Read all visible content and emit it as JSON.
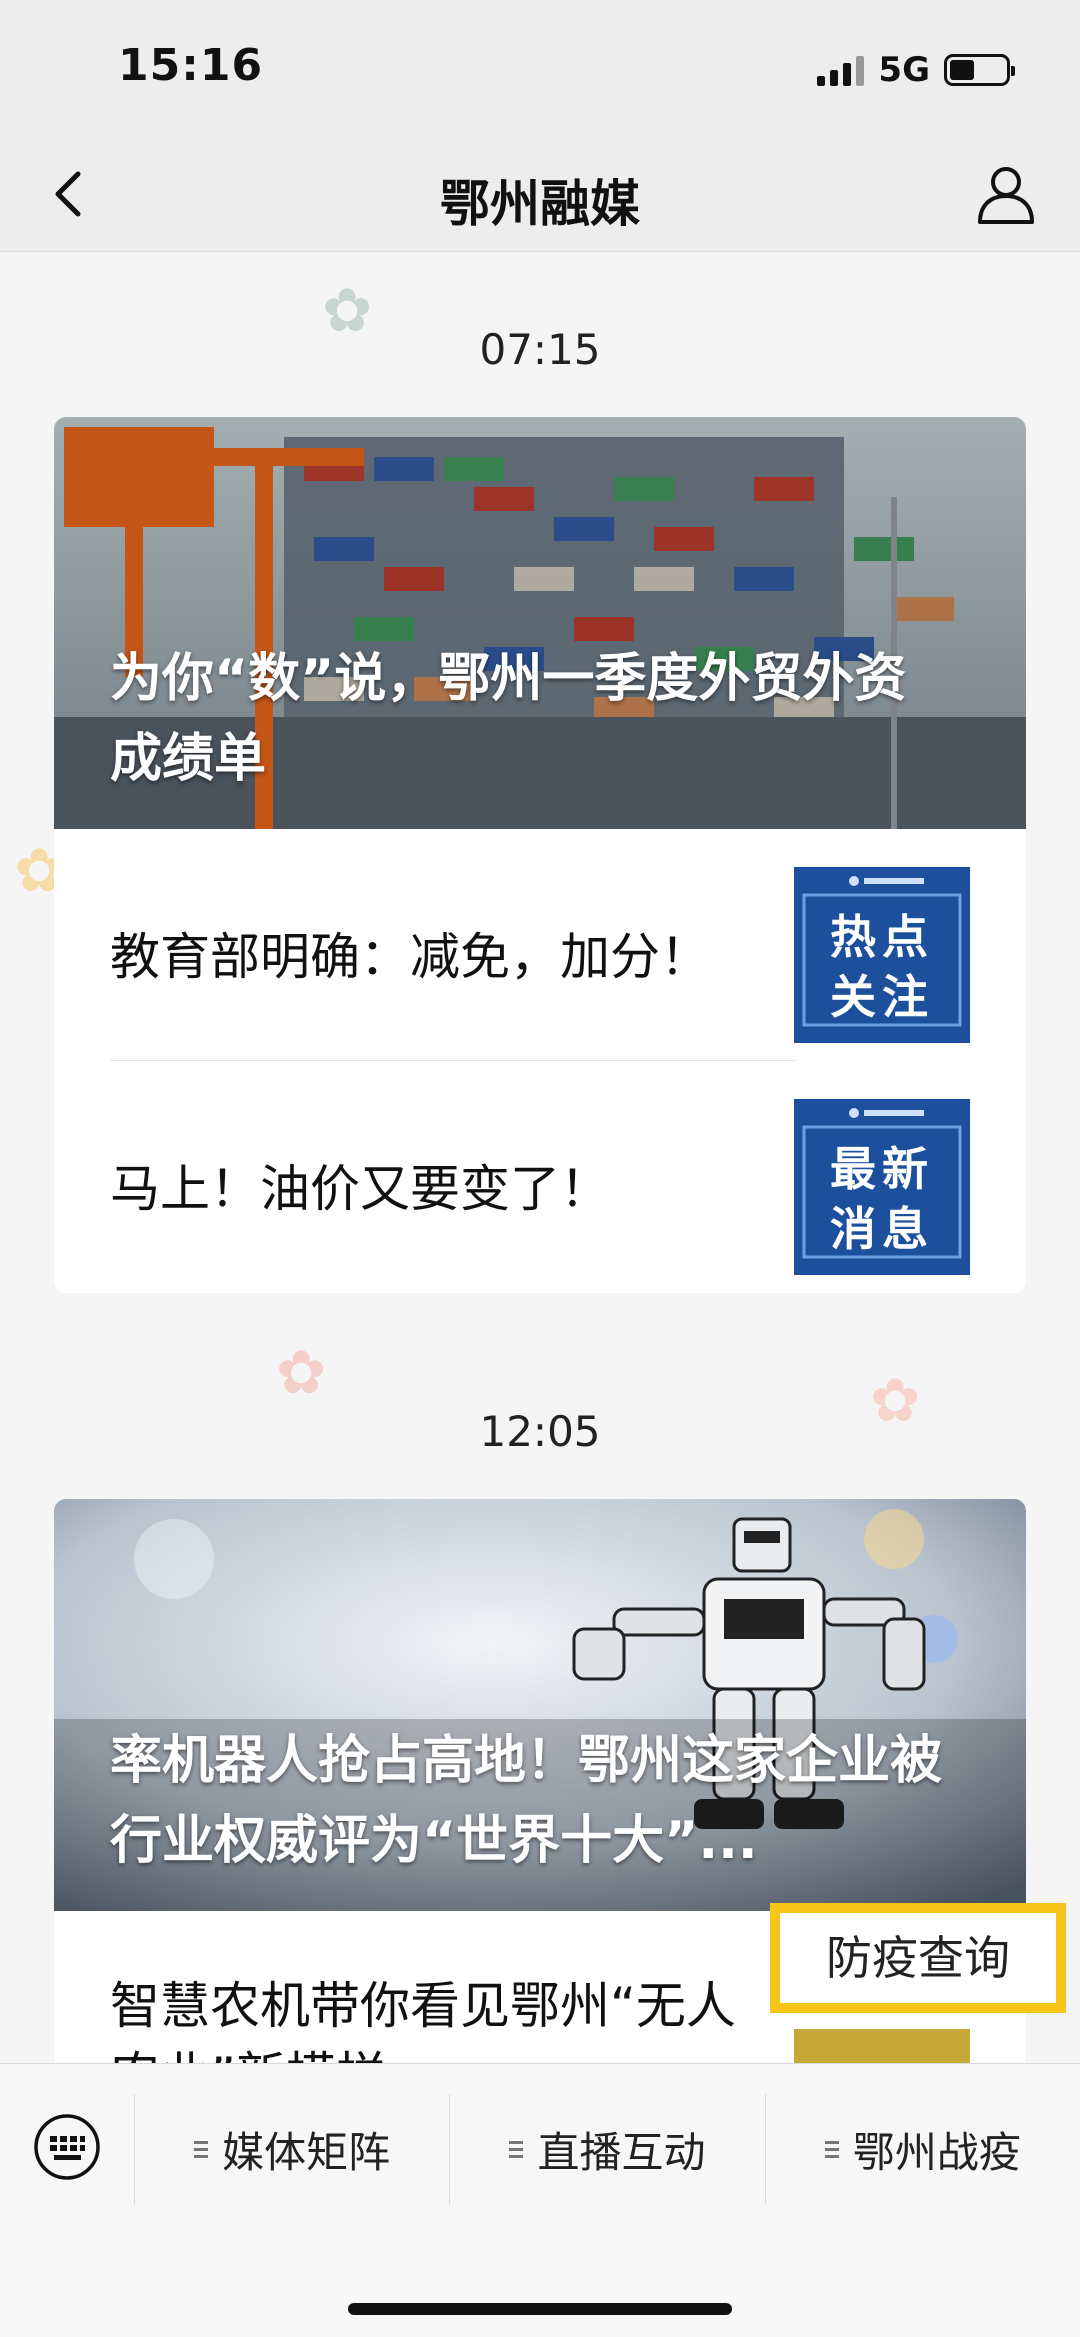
{
  "status": {
    "time": "15:16",
    "network": "5G"
  },
  "nav": {
    "title": "鄂州融媒"
  },
  "feed": [
    {
      "time": "07:15",
      "hero": {
        "title": "为你“数”说，鄂州一季度外贸外资成绩单"
      },
      "items": [
        {
          "title": "教育部明确：减免，加分！",
          "thumb_text": [
            "热点",
            "关注"
          ]
        },
        {
          "title": "马上！油价又要变了！",
          "thumb_text": [
            "最新",
            "消息"
          ]
        }
      ]
    },
    {
      "time": "12:05",
      "hero": {
        "title": "率机器人抢占高地！鄂州这家企业被行业权威评为“世界十大”..."
      },
      "items": [
        {
          "title": "智慧农机带你看见鄂州“无人农业”新模样"
        }
      ]
    }
  ],
  "floating_button": {
    "label": "防疫查询"
  },
  "bottom_menu": {
    "items": [
      {
        "label": "媒体矩阵"
      },
      {
        "label": "直播互动"
      },
      {
        "label": "鄂州战疫"
      }
    ]
  },
  "colors": {
    "highlight": "#f7c519",
    "thumb_blue": "#1c4f9c"
  }
}
